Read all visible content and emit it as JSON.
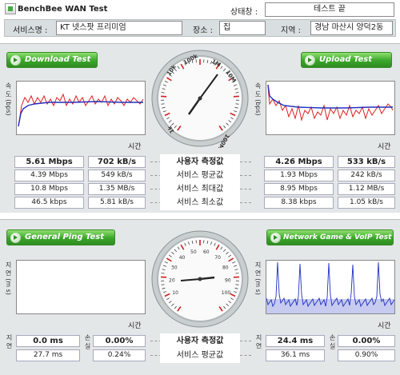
{
  "header": {
    "title": "BenchBee WAN Test",
    "status_label": "상태창 :",
    "status_value": "테스트 끝",
    "service_label": "서비스명 :",
    "service_value": "KT 넷스팟 프리미엄",
    "place_label": "장소 :",
    "place_value": "집",
    "region_label": "지역 :",
    "region_value": "경남 마산시 양덕2동"
  },
  "wan": {
    "download_button": "Download Test",
    "upload_button": "Upload Test",
    "y_label": "속 도 (bps)",
    "x_label": "시간",
    "gauge_labels": [
      "100k",
      "1M",
      "10k",
      "10M",
      "1k",
      "100M"
    ],
    "row_labels": [
      "사용자 측정값",
      "서비스 평균값",
      "서비스 최대값",
      "서비스 최소값"
    ],
    "download_rows": [
      [
        "5.61 Mbps",
        "702 kB/s"
      ],
      [
        "4.39 Mbps",
        "549 kB/s"
      ],
      [
        "10.8 Mbps",
        "1.35 MB/s"
      ],
      [
        "46.5 kbps",
        "5.81 kB/s"
      ]
    ],
    "upload_rows": [
      [
        "4.26 Mbps",
        "533 kB/s"
      ],
      [
        "1.93 Mbps",
        "242 kB/s"
      ],
      [
        "8.95 Mbps",
        "1.12 MB/s"
      ],
      [
        "8.38 kbps",
        "1.05 kB/s"
      ]
    ]
  },
  "ping": {
    "ping_button": "General Ping Test",
    "game_button": "Network Game & VoIP Test",
    "y_label": "지 연 (m s)",
    "x_label": "시간",
    "gauge_labels": [
      "10",
      "20",
      "30",
      "40",
      "50",
      "60",
      "70",
      "80",
      "90",
      "100"
    ],
    "row_labels": [
      "사용자 측정값",
      "서비스 평균값"
    ],
    "latency_label": "지 연",
    "loss_label": "손 실",
    "ping_rows": [
      [
        "0.0 ms",
        "0.00%"
      ],
      [
        "27.7 ms",
        "0.24%"
      ]
    ],
    "game_rows": [
      [
        "24.4 ms",
        "0.00%"
      ],
      [
        "36.1 ms",
        "0.90%"
      ]
    ]
  },
  "colors": {
    "button_green": "#3aa52a",
    "panel_gray": "#e3e7e8",
    "trace_red": "#e02020",
    "trace_blue": "#2030c0"
  }
}
